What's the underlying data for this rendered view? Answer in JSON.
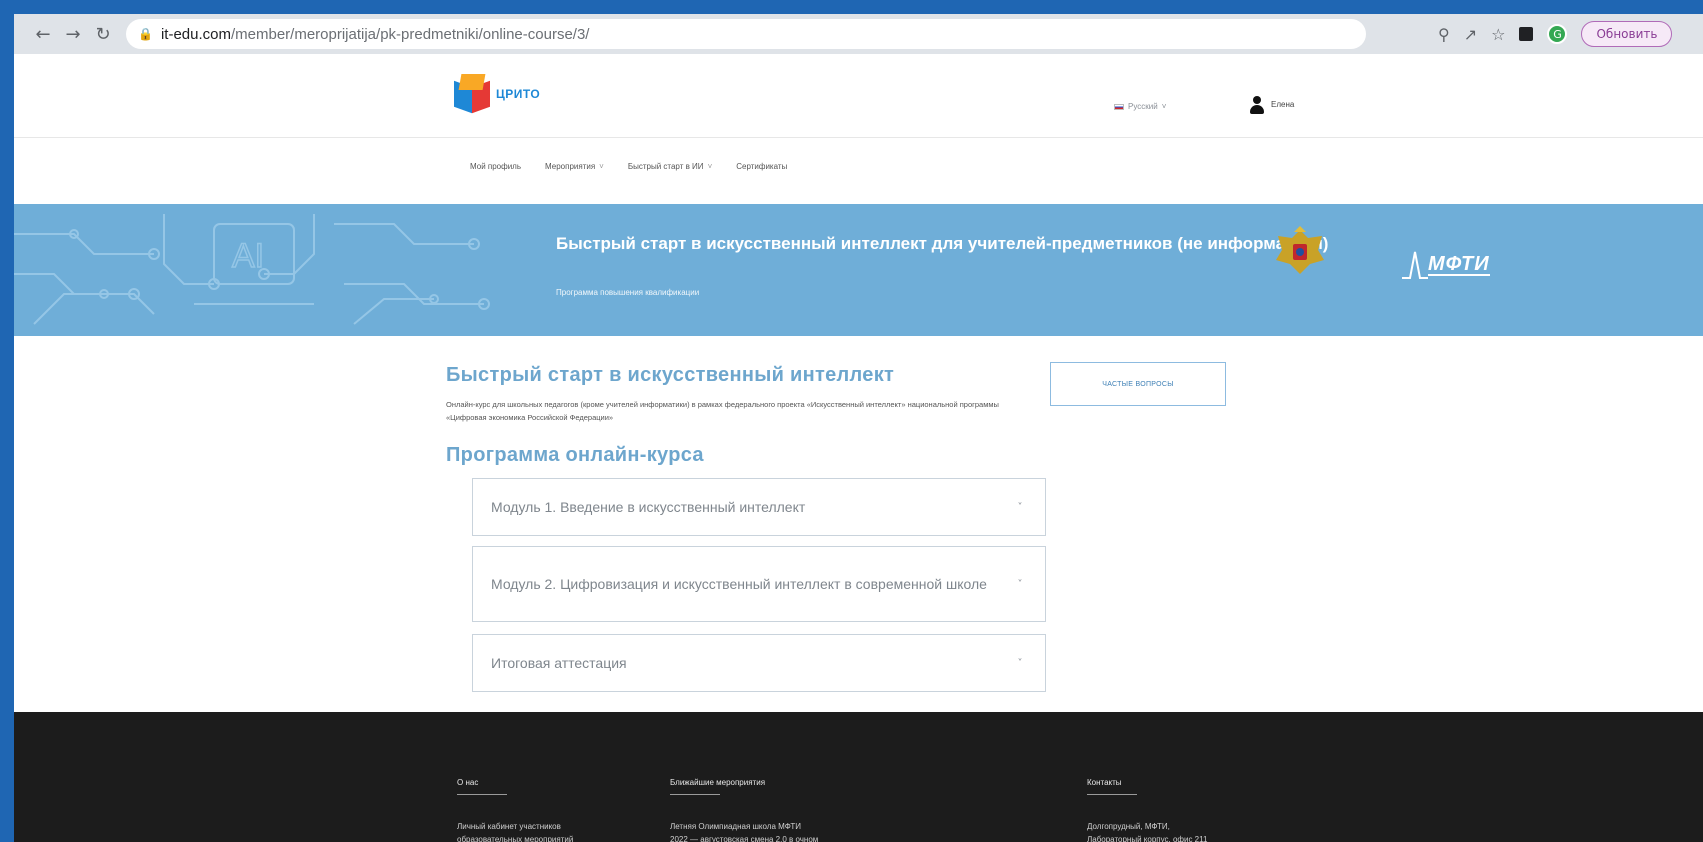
{
  "browser": {
    "url_host": "it-edu.com",
    "url_path": "/member/meroprijatija/pk-predmetniki/online-course/3/",
    "profile_letter": "G",
    "update_label": "Обновить"
  },
  "header": {
    "logo_name": "ЦРИТО",
    "logo_sub": "",
    "language": "Русский",
    "user_name": "Елена",
    "user_sub": ""
  },
  "nav": {
    "items": [
      {
        "label": "Мой профиль",
        "has_caret": false
      },
      {
        "label": "Мероприятия",
        "has_caret": true
      },
      {
        "label": "Быстрый старт в ИИ",
        "has_caret": true
      },
      {
        "label": "Сертификаты",
        "has_caret": false
      }
    ]
  },
  "banner": {
    "title": "Быстрый старт в искусственный интеллект для учителей-предметников (не информатики)",
    "subtitle": "Программа повышения квалификации",
    "emblem_caption": "",
    "partner": "МФТИ",
    "bg_color": "#6faed8"
  },
  "content": {
    "title": "Быстрый старт в искусственный интеллект",
    "description": "Онлайн-курс для школьных педагогов (кроме учителей информатики) в рамках федерального проекта «Искусственный интеллект» национальной программы «Цифровая экономика Российской Федерации»",
    "faq_label": "ЧАСТЫЕ ВОПРОСЫ",
    "program_title": "Программа онлайн-курса",
    "modules": [
      {
        "label": "Модуль 1. Введение в искусственный интеллект"
      },
      {
        "label": "Модуль 2. Цифровизация и искусственный интеллект в современной школе"
      },
      {
        "label": "Итоговая аттестация"
      }
    ],
    "accent_color": "#6da6cd"
  },
  "footer": {
    "about_head": "О нас",
    "about_text1": "Личный кабинет участников",
    "about_text2": "образовательных мероприятий",
    "events_head": "Ближайшие мероприятия",
    "events_text1": "Летняя Олимпиадная школа МФТИ",
    "events_text2": "2022 — августовская смена 2.0 в очном",
    "contacts_head": "Контакты",
    "contacts_text1": "Долгопрудный, МФТИ,",
    "contacts_text2": "Лабораторный корпус, офис 211"
  }
}
